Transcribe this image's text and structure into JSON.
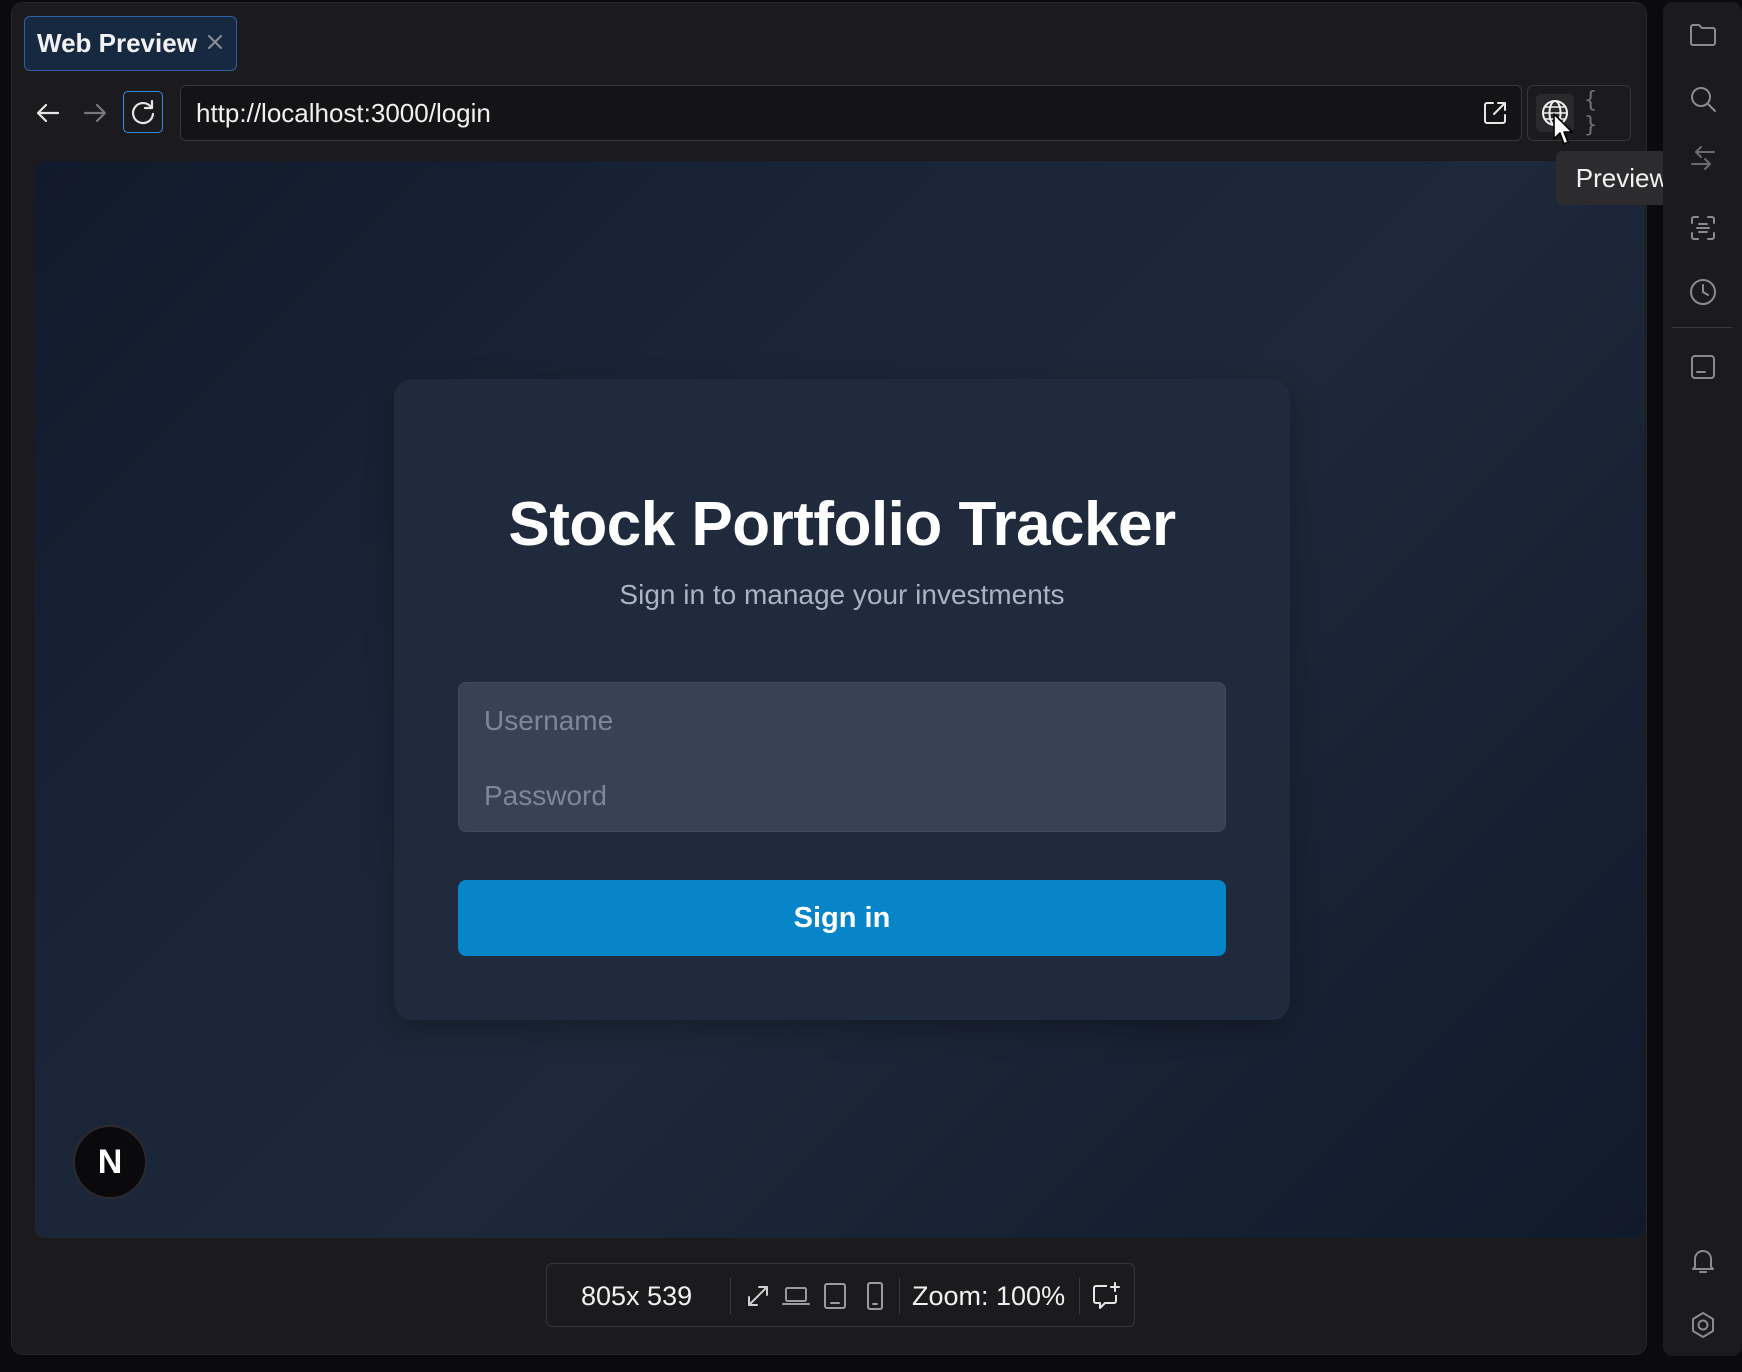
{
  "tab": {
    "label": "Web Preview"
  },
  "url_bar": {
    "url": "http://localhost:3000/login"
  },
  "tooltip": {
    "text": "Preview"
  },
  "mode_toggle": {
    "code_glyph": "{ }"
  },
  "login": {
    "title": "Stock Portfolio Tracker",
    "subtitle": "Sign in to manage your investments",
    "username_placeholder": "Username",
    "password_placeholder": "Password",
    "submit_label": "Sign in"
  },
  "next_badge": {
    "letter": "N"
  },
  "status_bar": {
    "size": "805x 539",
    "zoom": "Zoom: 100%"
  },
  "colors": {
    "accent": "#0785c9",
    "tab_border": "#2f5f9e",
    "reload_border": "#3a86e6"
  },
  "icons": {
    "nav": [
      "arrow-left-icon",
      "arrow-right-icon",
      "reload-icon",
      "open-external-icon",
      "globe-icon",
      "code-braces-icon"
    ],
    "status_bar": [
      "expand-icon",
      "laptop-icon",
      "tablet-icon",
      "phone-icon",
      "add-comment-icon"
    ],
    "rail": [
      "folder-icon",
      "search-icon",
      "compare-icon",
      "scan-icon",
      "history-icon",
      "panel-icon",
      "bell-icon",
      "settings-icon"
    ]
  }
}
